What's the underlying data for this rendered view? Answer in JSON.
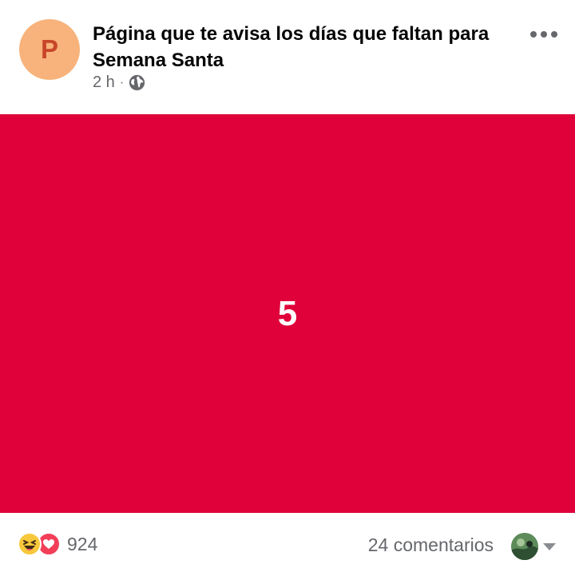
{
  "post": {
    "page_name": "Página que te avisa los días que faltan para Semana Santa",
    "avatar_letter": "P",
    "time": "2 h",
    "separator": "·",
    "privacy_icon": "globe-icon",
    "more_icon": "more-options-icon",
    "image_text": "5"
  },
  "footer": {
    "reaction_icons": [
      "haha-icon",
      "love-icon"
    ],
    "reaction_count": "924",
    "comments": "24 comentarios"
  },
  "colors": {
    "post_background": "#e0003a",
    "avatar_background": "#f7b37b",
    "avatar_letter": "#c8462a"
  }
}
